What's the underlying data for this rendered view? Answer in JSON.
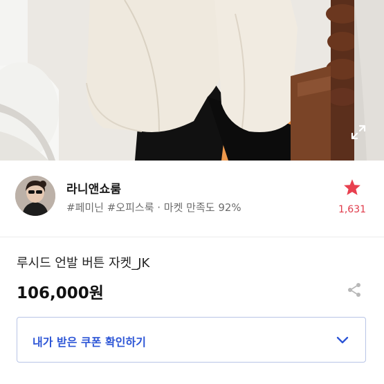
{
  "photo": {
    "alt_icon": "product-photo",
    "expand_icon": "expand-icon"
  },
  "seller": {
    "name": "라니앤쇼룸",
    "tags": "#페미닌 #오피스룩 · 마켓 만족도 92%",
    "favorite_count": "1,631",
    "favorite_icon": "star-icon"
  },
  "product": {
    "title": "루시드 언발 버튼 자켓_JK",
    "price": "106,000원",
    "share_icon": "share-icon"
  },
  "coupon": {
    "label": "내가 받은 쿠폰 확인하기",
    "chevron_icon": "chevron-down-icon"
  },
  "colors": {
    "accent_red": "#e8404f",
    "coupon_blue": "#2c55d6",
    "coupon_border": "#b8c4e6"
  }
}
